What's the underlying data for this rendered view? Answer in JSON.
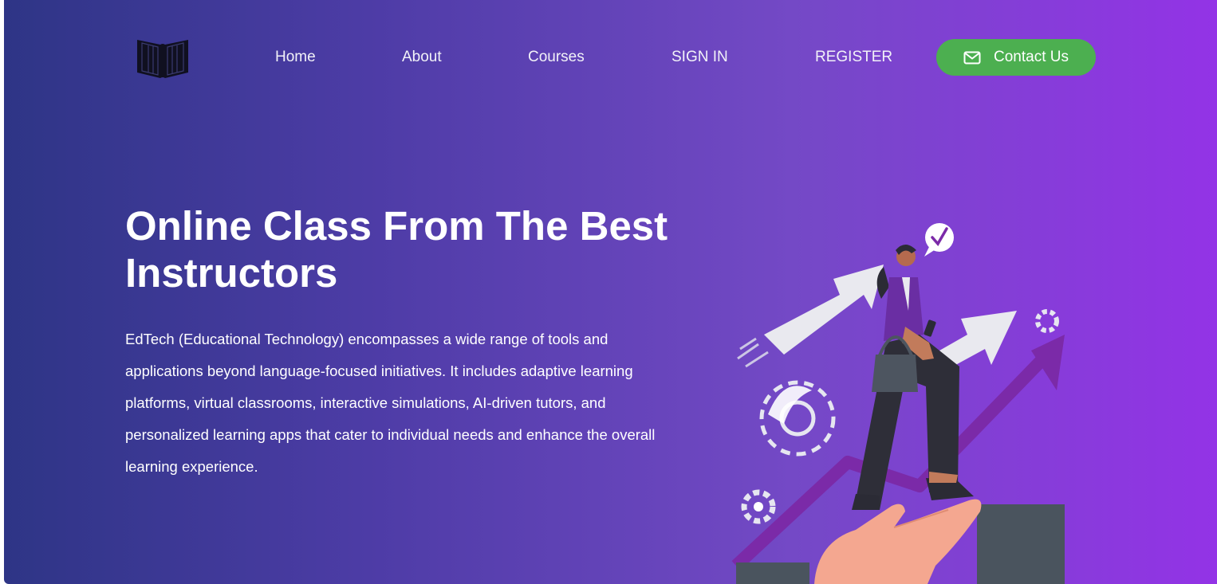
{
  "nav": {
    "logo_icon": "open-book-icon",
    "links": [
      "Home",
      "About",
      "Courses",
      "SIGN IN",
      "REGISTER"
    ],
    "contact": {
      "icon": "envelope-icon",
      "label": "Contact Us"
    }
  },
  "hero": {
    "title": "Online Class From The Best Instructors",
    "description": "EdTech (Educational Technology) encompasses a wide range of tools and applications beyond language-focused initiatives. It includes adaptive learning platforms, virtual classrooms, interactive simulations, AI-driven tutors, and personalized learning apps that cater to individual needs and enhance the overall learning experience."
  },
  "colors": {
    "gradient_start": "#2e3586",
    "gradient_end": "#9333e6",
    "accent_green": "#4caf50",
    "text": "#ffffff"
  }
}
